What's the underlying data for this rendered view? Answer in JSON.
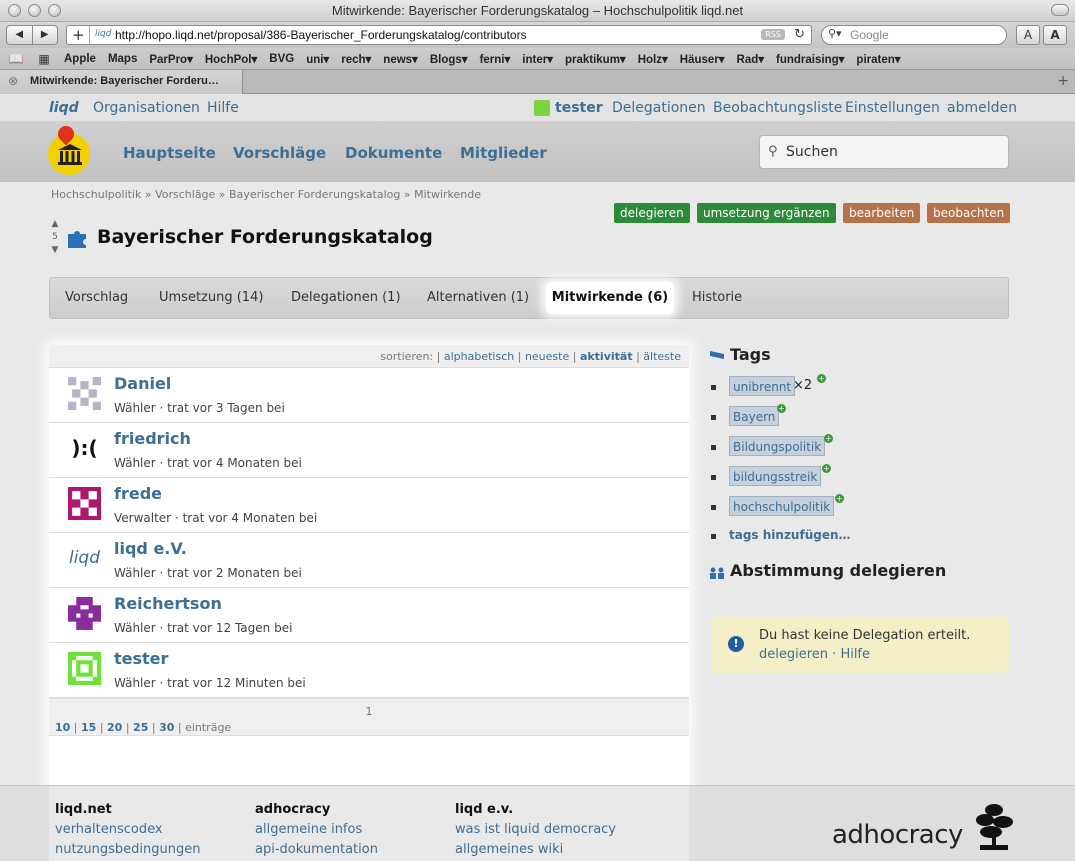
{
  "window": {
    "title": "Mitwirkende: Bayerischer Forderungskatalog – Hochschulpolitik liqd.net"
  },
  "toolbar": {
    "back": "◀",
    "forward": "▶",
    "url": "http://hopo.liqd.net/proposal/386-Bayerischer_Forderungskatalog/contributors",
    "favicon_text": "liqd",
    "rss": "RSS",
    "search_placeholder": "Google",
    "font_small": "A",
    "font_large": "A"
  },
  "bookmarks": [
    "Apple",
    "Maps",
    "ParPro▾",
    "HochPol▾",
    "BVG",
    "uni▾",
    "rech▾",
    "news▾",
    "Blogs▾",
    "ferni▾",
    "inter▾",
    "praktikum▾",
    "Holz▾",
    "Häuser▾",
    "Rad▾",
    "fundraising▾",
    "piraten▾"
  ],
  "tab": {
    "label": "Mitwirkende: Bayerischer Forderu…"
  },
  "topnav": {
    "logo": "liqd",
    "organisationen": "Organisationen",
    "hilfe": "Hilfe",
    "user": "tester",
    "delegationen": "Delegationen",
    "beobachtungsliste": "Beobachtungsliste",
    "einstellungen": "Einstellungen",
    "abmelden": "abmelden"
  },
  "mainnav": {
    "hauptseite": "Hauptseite",
    "vorschlaege": "Vorschläge",
    "dokumente": "Dokumente",
    "mitglieder": "Mitglieder",
    "search": "Suchen"
  },
  "breadcrumb": "Hochschulpolitik » Vorschläge » Bayerischer Forderungskatalog » Mitwirkende",
  "actions": {
    "delegieren": "delegieren",
    "umsetzung": "umsetzung ergänzen",
    "bearbeiten": "bearbeiten",
    "beobachten": "beobachten"
  },
  "proposal": {
    "votes": "5",
    "title": "Bayerischer Forderungskatalog"
  },
  "tabs": {
    "vorschlag": "Vorschlag",
    "umsetzung": "Umsetzung (14)",
    "delegationen": "Delegationen (1)",
    "alternativen": "Alternativen (1)",
    "mitwirkende": "Mitwirkende (6)",
    "historie": "Historie"
  },
  "sort": {
    "label": "sortieren:",
    "alphabetisch": "alphabetisch",
    "neueste": "neueste",
    "aktivitaet": "aktivität",
    "aelteste": "älteste"
  },
  "contributors": [
    {
      "name": "Daniel",
      "role": "Wähler",
      "joined": "trat vor 3 Tagen bei",
      "avatar_color": "#b8b4c8"
    },
    {
      "name": "friedrich",
      "role": "Wähler",
      "joined": "trat vor 4 Monaten bei",
      "avatar_text": "):("
    },
    {
      "name": "frede",
      "role": "Verwalter",
      "joined": "trat vor 4 Monaten bei",
      "avatar_color": "#b0186e"
    },
    {
      "name": "liqd e.V.",
      "role": "Wähler",
      "joined": "trat vor 2 Monaten bei",
      "avatar_text": "liqd"
    },
    {
      "name": "Reichertson",
      "role": "Wähler",
      "joined": "trat vor 12 Tagen bei",
      "avatar_color": "#8a2d9a"
    },
    {
      "name": "tester",
      "role": "Wähler",
      "joined": "trat vor 12 Minuten bei",
      "avatar_color": "#6fe23a"
    }
  ],
  "pager": {
    "page": "1",
    "sizes": [
      "10",
      "15",
      "20",
      "25",
      "30"
    ],
    "entries": "einträge"
  },
  "sidebar": {
    "tags_heading": "Tags",
    "tags": [
      {
        "label": "unibrennt",
        "count": "×2"
      },
      {
        "label": "Bayern"
      },
      {
        "label": "Bildungspolitik"
      },
      {
        "label": "bildungsstreik"
      },
      {
        "label": "hochschulpolitik"
      }
    ],
    "add_tags": "tags hinzufügen…",
    "delegate_heading": "Abstimmung delegieren",
    "delegate_msg": "Du hast keine Delegation erteilt.",
    "delegate_link": "delegieren",
    "help_link": "Hilfe"
  },
  "footer": {
    "col1": {
      "heading": "liqd.net",
      "links": [
        "verhaltenscodex",
        "nutzungsbedingungen"
      ]
    },
    "col2": {
      "heading": "adhocracy",
      "links": [
        "allgemeine infos",
        "api-dokumentation"
      ]
    },
    "col3": {
      "heading": "liqd e.v.",
      "links": [
        "was ist liquid democracy",
        "allgemeines wiki"
      ]
    },
    "brand": "adhocracy"
  },
  "colors": {
    "link": "#3d6e93",
    "green_button": "#2c8a3a",
    "brown_button": "#b5714a",
    "notice_bg": "#f5efc7"
  }
}
